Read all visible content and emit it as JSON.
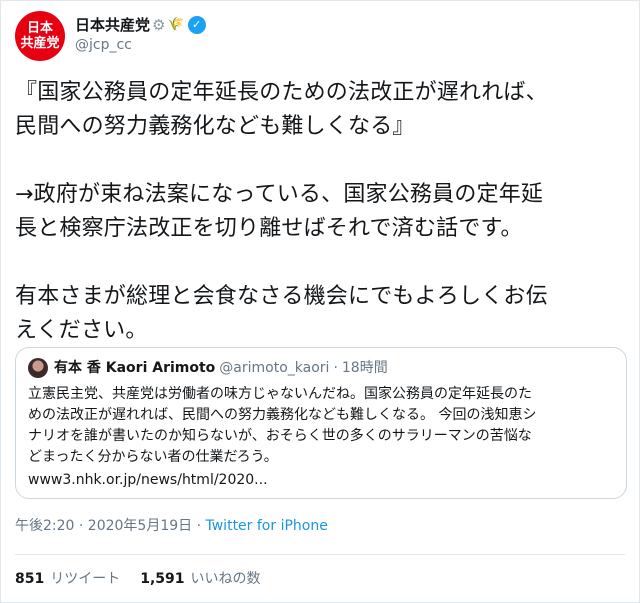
{
  "account": {
    "avatar_line1": "日本",
    "avatar_line2": "共産党",
    "name": "日本共産党",
    "handle": "@jcp_cc"
  },
  "tweet": {
    "lines": [
      "『国家公務員の定年延長のための法改正が遅れれば、",
      "民間への努力義務化なども難しくなる』",
      "→政府が束ね法案になっている、国家公務員の定年延",
      "長と検察庁法改正を切り離せばそれで済む話です。",
      "有本さまが総理と会食なさる機会にでもよろしくお伝",
      "えください。"
    ]
  },
  "quoted": {
    "name": "有本 香 Kaori Arimoto",
    "handle": "@arimoto_kaori",
    "time": "18時間",
    "text_lines": [
      "立憲民主党、共産党は労働者の味方じゃないんだね。国家公務員の定年延長のた",
      "めの法改正が遅れれば、民間への努力義務化なども難しくなる。 今回の浅知恵シ",
      "ナリオを誰が書いたのか知らないが、おそらく世の多くのサラリーマンの苦悩な",
      "どまったく分からない者の仕業だろう。"
    ],
    "link": "www3.nhk.or.jp/news/html/2020..."
  },
  "meta": {
    "timestamp": "午後2:20 · 2020年5月19日 · ",
    "source": "Twitter for iPhone"
  },
  "stats": {
    "retweets": "851",
    "retweets_label": "リツイート",
    "likes": "1,591",
    "likes_label": "いいねの数"
  },
  "colors": {
    "accent": "#1da1f2",
    "brand": "#e60012"
  },
  "icons": [
    "gear-icon",
    "leaf-icon",
    "verified-icon"
  ]
}
